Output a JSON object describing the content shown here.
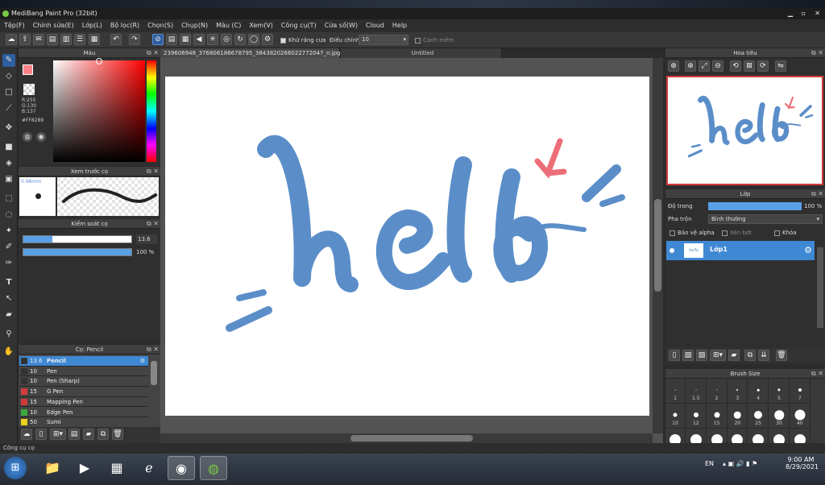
{
  "window": {
    "title": "MediBang Paint Pro (32bit)"
  },
  "menu": [
    "Tệp(F)",
    "Chỉnh sửa(E)",
    "Lớp(L)",
    "Bộ lọc(R)",
    "Chọn(S)",
    "Chụp(N)",
    "Màu (C)",
    "Xem(V)",
    "Công cụ(T)",
    "Cửa sổ(W)",
    "Cloud",
    "Help"
  ],
  "toolbar": {
    "antialias_label": "Khử răng cưa",
    "adjust_label": "Điều chỉnh",
    "adjust_value": "10",
    "snap_label": "Cạnh mềm"
  },
  "color_panel": {
    "title": "Màu",
    "r": "R:255",
    "g": "G:130",
    "b": "B:137",
    "hex": "#FF8289",
    "fg": "#ff8289",
    "bg": "#3a6bbd"
  },
  "brush_preview": {
    "title": "Xem trước cọ",
    "size": "0.98mm"
  },
  "brush_control": {
    "title": "Kiểm soát cọ",
    "size_value": "13.6",
    "opacity_value": "100 %",
    "size_fraction": 0.27,
    "opacity_fraction": 1.0
  },
  "brush_list": {
    "title": "Cọ: Pencil",
    "items": [
      {
        "size": "13.6",
        "name": "Pencil",
        "color": "#333333"
      },
      {
        "size": "10",
        "name": "Pen",
        "color": "#333333"
      },
      {
        "size": "10",
        "name": "Pen (Sharp)",
        "color": "#333333"
      },
      {
        "size": "15",
        "name": "G Pen",
        "color": "#d23b3b"
      },
      {
        "size": "15",
        "name": "Mapping Pen",
        "color": "#d23b3b"
      },
      {
        "size": "10",
        "name": "Edge Pen",
        "color": "#3aa83a"
      },
      {
        "size": "50",
        "name": "Sumi",
        "color": "#e8d21c"
      }
    ]
  },
  "tabs": [
    {
      "label": "239606948_376806186678795_3843820266022772047_n.jpg < c2 >"
    },
    {
      "label": "Untitled"
    }
  ],
  "canvas": {
    "artwork_text": "hello",
    "artwork_color": "#5b8ec9",
    "arrow_color": "#ec6e78"
  },
  "navigator": {
    "title": "Hoa tiêu"
  },
  "layer_panel": {
    "title": "Lớp",
    "opacity_label": "Độ trong",
    "opacity_value": "100 %",
    "blend_label": "Pha trộn",
    "blend_value": "Bình thường",
    "protect_alpha": "Bảo vệ alpha",
    "clipping": "Xén bớt",
    "lock": "Khóa",
    "layer_name": "Lớp1",
    "thumb_text": "hello"
  },
  "brush_size": {
    "title": "Brush Size",
    "sizes": [
      "1",
      "1.5",
      "2",
      "3",
      "4",
      "5",
      "7",
      "10",
      "12",
      "15",
      "20",
      "25",
      "30",
      "40"
    ],
    "dots": [
      0.6,
      1,
      1.4,
      2,
      2.6,
      3.2,
      4,
      5,
      6,
      7,
      8.5,
      10,
      11.5,
      13
    ],
    "third_row_dots": [
      14,
      14,
      14,
      14,
      14,
      14,
      14
    ]
  },
  "status": {
    "text": "Công cụ cọ"
  },
  "taskbar": {
    "lang": "EN",
    "time": "9:00 AM",
    "date": "8/29/2021"
  }
}
